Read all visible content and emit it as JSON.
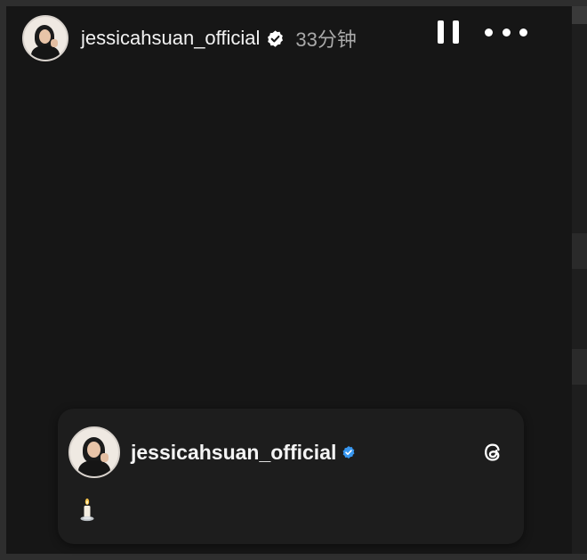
{
  "story": {
    "header": {
      "username": "jessicahsuan_official",
      "time": "33分钟"
    }
  },
  "post_card": {
    "username": "jessicahsuan_official",
    "body_emoji": "🕯️"
  },
  "colors": {
    "background": "#161616",
    "card": "#1d1d1d",
    "verified_blue": "#3897f0",
    "text": "#f2f2f2",
    "muted_text": "#a9a9a9"
  },
  "icons": {
    "header_verified": "verified-badge-icon",
    "pause": "pause-icon",
    "more": "more-icon",
    "card_verified": "verified-badge-icon",
    "threads": "threads-icon",
    "candle": "candle-icon"
  }
}
